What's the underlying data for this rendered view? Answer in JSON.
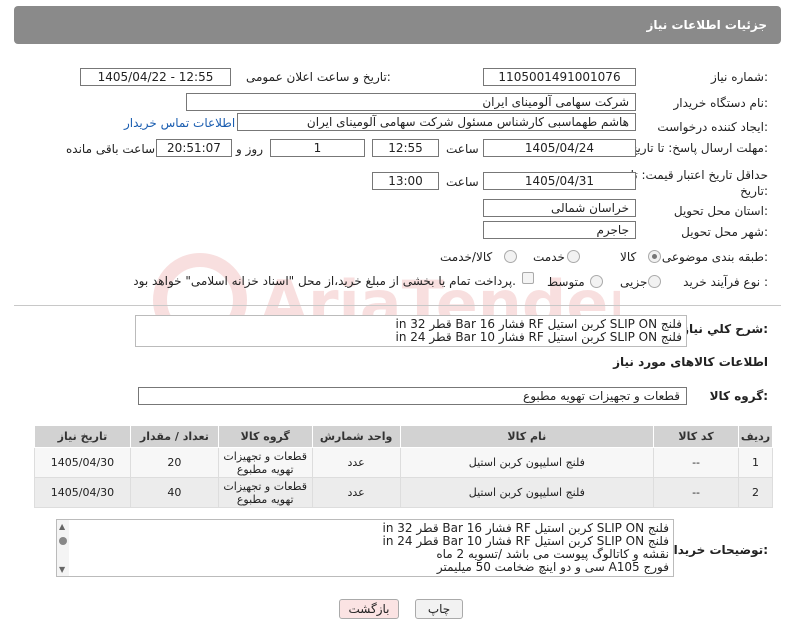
{
  "header": {
    "title": "جزئیات اطلاعات نیاز"
  },
  "fields": {
    "need_number_label": "شماره نیاز:",
    "need_number": "1105001491001076",
    "announce_label": "تاریخ و ساعت اعلان عمومی:",
    "announce_value": "1405/04/22 - 12:55",
    "buyer_org_label": "نام دستگاه خریدار:",
    "buyer_org": "شرکت سهامی آلومینای ایران",
    "creator_label": "ایجاد کننده درخواست:",
    "creator": "هاشم طهماسبی کارشناس مسئول شرکت سهامی آلومینای ایران",
    "contact_link": "اطلاعات تماس خریدار",
    "reply_deadline_label": "مهلت ارسال پاسخ: تا تاریخ:",
    "reply_date": "1405/04/24",
    "time_label": "ساعت",
    "reply_time": "12:55",
    "days_value": "1",
    "days_label": "روز و",
    "remaining_time": "20:51:07",
    "remaining_label": "ساعت باقی مانده",
    "price_validity_label": "حداقل تاریخ اعتبار قیمت: تا تاریخ:",
    "validity_date": "1405/04/31",
    "validity_time": "13:00",
    "province_label": "استان محل تحویل:",
    "province": "خراسان شمالی",
    "city_label": "شهر محل تحویل:",
    "city": "جاجرم",
    "category_label": "طبقه بندی موضوعی:",
    "category_options": [
      "کالا",
      "خدمت",
      "کالا/خدمت"
    ],
    "process_label": "نوع فرآیند خرید :",
    "process_options": [
      "جزیی",
      "متوسط"
    ],
    "payment_text": "پرداخت تمام یا بخشی از مبلغ خرید،از محل \"اسناد خزانه اسلامی\" خواهد بود."
  },
  "summary": {
    "label": "شرح کلي نياز:",
    "lines": [
      "فلنج SLIP ON کربن استیل RF فشار Bar 16 قطر 32 in",
      "فلنج SLIP ON کربن استیل RF فشار Bar 10 قطر 24 in"
    ]
  },
  "goods": {
    "section_title": "اطلاعات کالاهای مورد نیاز",
    "group_label": "گروه کالا:",
    "group_value": "قطعات و تجهیزات تهویه مطبوع",
    "columns": [
      "ردیف",
      "کد کالا",
      "نام کالا",
      "واحد شمارش",
      "گروه کالا",
      "تعداد / مقدار",
      "تاریخ نیاز"
    ],
    "rows": [
      {
        "row": "1",
        "code": "--",
        "name": "فلنج اسلیپون کربن استیل",
        "unit": "عدد",
        "group": "قطعات و تجهیزات تهویه مطبوع",
        "qty": "20",
        "date": "1405/04/30"
      },
      {
        "row": "2",
        "code": "--",
        "name": "فلنج اسلیپون کربن استیل",
        "unit": "عدد",
        "group": "قطعات و تجهیزات تهویه مطبوع",
        "qty": "40",
        "date": "1405/04/30"
      }
    ]
  },
  "buyer_notes": {
    "label": "توضیحات خریدار:",
    "lines": [
      "فلنج SLIP ON کربن استیل RF فشار Bar 16 قطر 32 in",
      "فلنج SLIP ON کربن استیل RF فشار Bar 10 قطر 24 in",
      "نقشه و کاتالوگ پیوست می باشد /تسویه 2 ماه",
      "فورج A105   سی و دو اینچ ضخامت 50 میلیمتر"
    ]
  },
  "buttons": {
    "print": "چاپ",
    "back": "بازگشت"
  },
  "watermark": "AriaTender.net",
  "colors": {
    "header": "#8a8a8a",
    "back_button": "#fbe3e3",
    "print_button": "#f2f2f2",
    "link": "#1a5db0"
  }
}
